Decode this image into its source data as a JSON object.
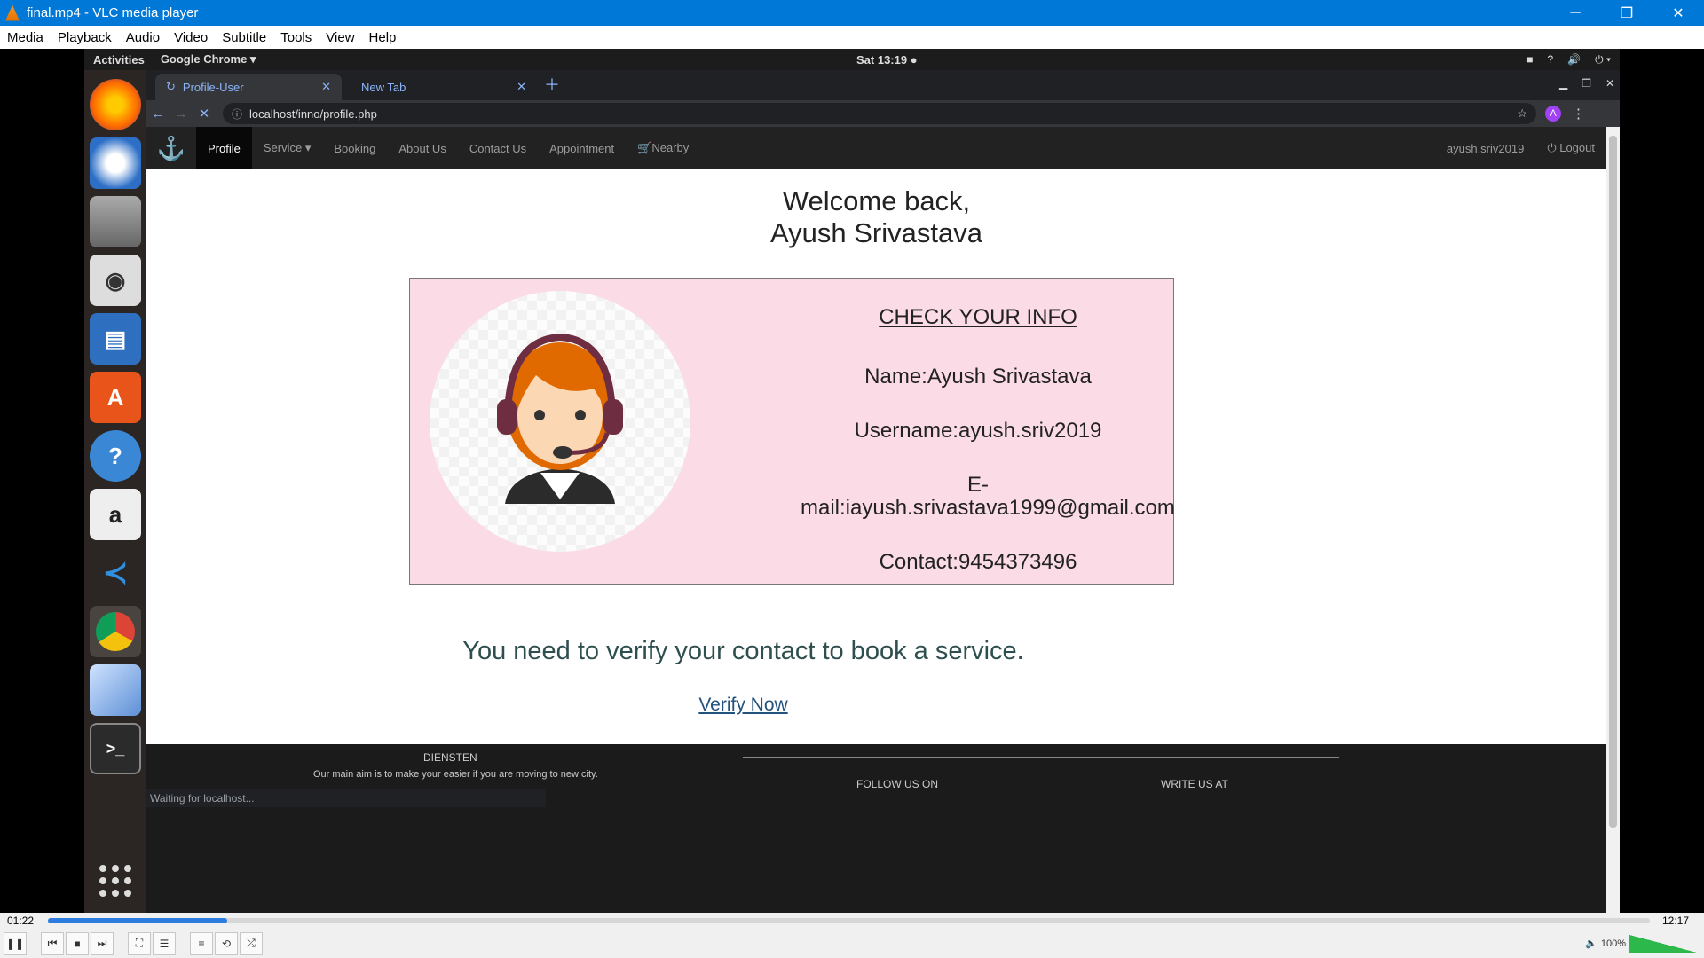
{
  "vlc": {
    "title": "final.mp4 - VLC media player",
    "menu": [
      "Media",
      "Playback",
      "Audio",
      "Video",
      "Subtitle",
      "Tools",
      "View",
      "Help"
    ],
    "time_elapsed": "01:22",
    "time_total": "12:17",
    "progress": 0.112,
    "volume_label": "100%"
  },
  "ubuntu": {
    "activities": "Activities",
    "app_menu": "Google Chrome ▾",
    "clock": "Sat 13:19 ●"
  },
  "chrome": {
    "tab1": "Profile-User",
    "tab2": "New Tab",
    "url": "localhost/inno/profile.php",
    "avatar_letter": "A",
    "status": "Waiting for localhost..."
  },
  "site": {
    "nav": {
      "profile": "Profile",
      "service": "Service ▾",
      "booking": "Booking",
      "about": "About Us",
      "contact": "Contact Us",
      "appointment": "Appointment",
      "nearby": "🛒Nearby",
      "user": "ayush.sriv2019",
      "logout": "⏻ Logout"
    },
    "welcome_line1": "Welcome back,",
    "welcome_line2": "Ayush Srivastava",
    "info": {
      "heading": "CHECK YOUR INFO",
      "name": "Name:Ayush Srivastava",
      "username": "Username:ayush.sriv2019",
      "email_1": "E-",
      "email_2": "mail:iayush.srivastava1999@gmail.com",
      "contact": "Contact:9454373496"
    },
    "verify_message": "You need to verify your contact to book a service.",
    "verify_link": "Verify Now",
    "footer": {
      "heading": "DIENSTEN",
      "aim": "Our main aim is to make your easier if you are moving to new city.",
      "follow": "FOLLOW US ON",
      "write": "WRITE US AT"
    }
  }
}
